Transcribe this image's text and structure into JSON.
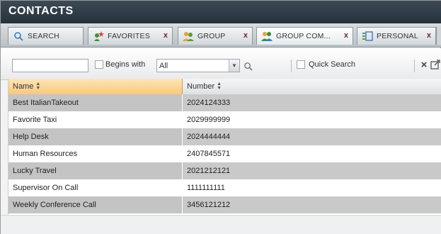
{
  "window": {
    "title": "CONTACTS"
  },
  "tabs": [
    {
      "label": "SEARCH",
      "icon": "search-icon",
      "closable": false
    },
    {
      "label": "FAVORITES",
      "icon": "favorites-icon",
      "closable": true
    },
    {
      "label": "GROUP",
      "icon": "group-icon",
      "closable": true
    },
    {
      "label": "GROUP COM...",
      "icon": "group-common-icon",
      "closable": true
    },
    {
      "label": "PERSONAL",
      "icon": "personal-icon",
      "closable": true
    }
  ],
  "tab_close_glyph": "x",
  "toolbar": {
    "search_value": "",
    "begins_with_label": "Begins with",
    "begins_with_checked": false,
    "filter_selected": "All",
    "quick_search_label": "Quick Search",
    "quick_search_checked": false
  },
  "table": {
    "columns": [
      "Name",
      "Number"
    ],
    "rows": [
      [
        "Best ItalianTakeout",
        "2024124333"
      ],
      [
        "Favorite Taxi",
        "2029999999"
      ],
      [
        "Help Desk",
        "2024444444"
      ],
      [
        "Human Resources",
        "2407845571"
      ],
      [
        "Lucky Travel",
        "2021212121"
      ],
      [
        "Supervisor On Call",
        "1111111111"
      ],
      [
        "Weekly Conference Call",
        "3456121212"
      ]
    ]
  },
  "colors": {
    "titlebar": "#2f3b44",
    "header_sorted": "#f7c97a",
    "row_shaded": "#c9c9c9"
  }
}
